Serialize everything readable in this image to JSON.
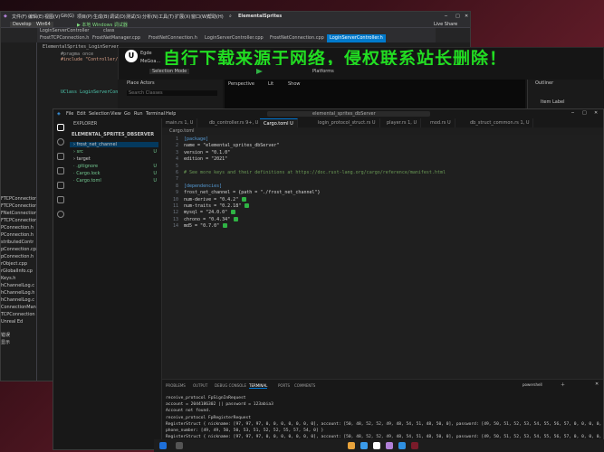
{
  "vs": {
    "title": "ElementalSprites",
    "menu": [
      "文件(F)",
      "编辑(E)",
      "视图(V)",
      "Git(G)",
      "项目(P)",
      "生成(B)",
      "调试(D)",
      "测试(S)",
      "分析(N)",
      "工具(T)",
      "扩展(X)",
      "窗口(W)",
      "帮助(H)"
    ],
    "config": "Develop",
    "platform": "Win64",
    "windows_debugger": "▶ 本地 Windows 调试器",
    "live_share": "Live Share",
    "tabs": [
      "FrostTCPConnection.h",
      "FrostNetManager.cpp",
      "FrostNetConnection.h",
      "LoginServerController.cpp",
      "FrostNetConnection.cpp",
      "LoginServerController.h"
    ],
    "secondary_tabs": [
      "LoginServerController",
      "class"
    ],
    "editor_lines": [
      "ElementalSprites_LoginServer",
      "#pragma once",
      "#include \"Controller/FrostNet...\"",
      "UClass LoginServerController : pu"
    ],
    "solution_items": [
      "FTCPConnection.cpp",
      "FTCPConnection.h",
      "FNetConnection.h",
      "FTCPConnection.h",
      "PConnection.h",
      "PConnection.h",
      "stributedContr",
      "pConnection.cpp",
      "pConnection.h",
      "rObject.cpp",
      "rGlobalInfo.cp",
      "Keys.h",
      "hChannelLog.c",
      "hChannelLog.h",
      "hChannelLog.c",
      "ConnectionMan",
      "TCPConnection",
      "Unreal Ed"
    ],
    "side_labels": [
      "错误",
      "显示"
    ]
  },
  "ue": {
    "tabs": [
      "Egde",
      "MeGoa..."
    ],
    "selection_mode": "Selection Mode",
    "platforms": "Platforms",
    "place_actors": "Place Actors",
    "search_classes": "Search Classes",
    "perspective": "Perspective",
    "lit": "Lit",
    "show": "Show",
    "outliner": "Outliner",
    "item_label": "Item Label"
  },
  "watermark": "自行下载来源于网络，侵权联系站长删除！",
  "vscode": {
    "menu": [
      "File",
      "Edit",
      "Selection",
      "View",
      "Go",
      "Run",
      "Terminal",
      "Help"
    ],
    "search_text": "elemental_sprites_dbServer",
    "explorer_title": "EXPLORER",
    "project": "ELEMENTAL_SPRITES_DBSERVER",
    "tree": [
      {
        "name": "frost_net_channel",
        "kind": "folder"
      },
      {
        "name": "src",
        "kind": "folder"
      },
      {
        "name": "target",
        "kind": "folder"
      },
      {
        "name": ".gitignore",
        "kind": "file"
      },
      {
        "name": "Cargo.lock",
        "kind": "file"
      },
      {
        "name": "Cargo.toml",
        "kind": "file"
      }
    ],
    "tree_badges": [
      "",
      "U",
      "",
      "U",
      "U",
      "U"
    ],
    "tabs": [
      {
        "label": "main.rs 1, U",
        "active": false
      },
      {
        "label": "db_controller.rs 9+, U",
        "active": false
      },
      {
        "label": "Cargo.toml U",
        "active": true
      },
      {
        "label": "login_protocol_struct.rs U",
        "active": false
      },
      {
        "label": "player.rs 1, U",
        "active": false
      },
      {
        "label": "mod.rs U",
        "active": false
      },
      {
        "label": "db_struct_common.rs 1, U",
        "active": false
      }
    ],
    "breadcrumb": "Cargo.toml",
    "code_lines": [
      {
        "n": "1",
        "text": "[package]",
        "ok": false
      },
      {
        "n": "2",
        "text": "name = \"elemental_sprites_dbServer\"",
        "ok": false
      },
      {
        "n": "3",
        "text": "version = \"0.1.0\"",
        "ok": false
      },
      {
        "n": "4",
        "text": "edition = \"2021\"",
        "ok": false
      },
      {
        "n": "5",
        "text": "",
        "ok": false
      },
      {
        "n": "6",
        "text": "# See more keys and their definitions at https://doc.rust-lang.org/cargo/reference/manifest.html",
        "ok": false
      },
      {
        "n": "7",
        "text": "",
        "ok": false
      },
      {
        "n": "8",
        "text": "[dependencies]",
        "ok": false
      },
      {
        "n": "9",
        "text": "frost_net_channel = {path = \"./frost_net_channel\"}",
        "ok": false
      },
      {
        "n": "10",
        "text": "num-derive = \"0.4.2\"",
        "ok": true
      },
      {
        "n": "11",
        "text": "num-traits = \"0.2.18\"",
        "ok": true
      },
      {
        "n": "12",
        "text": "mysql = \"24.0.0\"",
        "ok": true
      },
      {
        "n": "13",
        "text": "chrono = \"0.4.34\"",
        "ok": true
      },
      {
        "n": "14",
        "text": "md5 = \"0.7.0\"",
        "ok": true
      }
    ],
    "panel_tabs": [
      "PROBLEMS",
      "OUTPUT",
      "DEBUG CONSOLE",
      "TERMINAL",
      "PORTS",
      "COMMENTS"
    ],
    "panel_active": "TERMINAL",
    "terminal_shell": "powershell",
    "terminal_lines": [
      "receive_protocol  FpSignInRequest",
      "account = 2044186302 || password = 123abia3",
      "Account not found.",
      "receive_protocol  FpRegisterRequest",
      "RegisterStruct { nickname: [97, 97, 97, 0, 0, 0, 0, 0, 0, 0], account: [50, 48, 52, 52, 49, 48, 54, 51, 48, 50, 0], password: [49, 50, 51, 52, 53, 54, 55, 56, 57, 0, 0, 0, 0, 0, 0, 0, 0],",
      " phone_number: [49, 49, 50, 50, 53, 51, 52, 52, 55, 57, 54, 0] }",
      "RegisterStruct { nickname: [97, 97, 97, 0, 0, 0, 0, 0, 0, 0], account: [50, 48, 52, 52, 49, 48, 54, 51, 48, 50, 0], password: [49, 50, 51, 52, 53, 54, 55, 56, 57, 0, 0, 0, 0, 0, 0, 0, 0],"
    ]
  },
  "colors": {
    "accent": "#0078d4",
    "vs_accent": "#007acc",
    "watermark": "#22dd22",
    "ok_badge": "#2fb344"
  }
}
